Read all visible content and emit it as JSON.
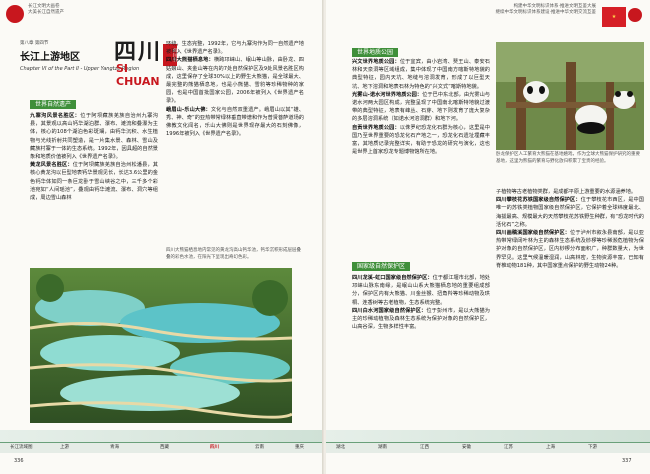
{
  "left_page": {
    "header": {
      "logo_text_1": "长江文明大画卷",
      "logo_text_2": "大美长江自然遗产"
    },
    "chapter": {
      "prefix_cn": "长江上游地区",
      "chapter_no": "第八章 第四节",
      "chapter_en": "Chapter VI of the Part II - Upper Yangtze Region",
      "name_cn": "四川",
      "name_en": "SI CHUAN",
      "code": "四川省"
    },
    "tag_natural_heritage": "世界自然遗产",
    "sections": [
      {
        "title": "九寨沟风景名胜区：",
        "text": "位于阿坝藏族羌族自治州九寨沟县，其景观以高山钙华湖泊群、瀑布、滩流和叠瀑为主体，核心的108个湖泊色彩斑斓，由钙华沉积、水生植物与光线折射共同塑造，是一片集水景、森林、雪山及藏族村寨于一体的生态系统。1992年，因具超的自然景象和地质价值被列入《世界遗产名录》。"
      },
      {
        "title": "黄龙风景名胜区：",
        "text": "位于阿坝藏族羌族自治州松潘县，其核心黄龙沟以巨型地表钙华景观见长，长达3.6公里的金色钙华体如同一条巨龙卧于雪山峡谷之中，三千多个彩池宛如“人间瑶池”，叠观由钙华滩流、瀑布、洞穴等组成，周边雪山森林"
      }
    ],
    "col2_sections": [
      {
        "title": "",
        "text": "环绕，生态完整，1992年，它与九寨沟作为同一自然遗产地被列入《世界遗产名录》。"
      },
      {
        "title": "四川大熊猫栖息地：",
        "text": "横跨邛崃山、岷山等山脉，由卧龙、四姑娘山、夹金山等在内的7处自然保护区及9处风景名胜区构成，这里保存了全球30%以上的野生大熊猫，是全球最大、最完整的熊猫栖息地，也是小熊猫、雪豹等珍稀物种的家园，也是中国首批国家公园，2006年被列入《世界遗产名录》。"
      },
      {
        "title": "峨眉山-乐山大佛：",
        "text": "文化与自然双重遗产。峨眉山以其“雄、秀、神、奇”的亚热带常绿林垂直带谱和作为普贤菩萨道场的佛教文化闻名，乐山大佛则是世界现存最大的石刻佛像，1996年被列入《世界遗产名录》。"
      }
    ],
    "photo_note": "四川大熊猫栖息地内常见的黄龙沟高山钙华池，钙华沉积形成层层叠叠的彩色水池，在阳光下呈现出奇幻色彩。",
    "bottom_nav": {
      "label": "长江流域图",
      "page_number": "336",
      "places": [
        "上游",
        "青海",
        "西藏",
        "四川",
        "云南",
        "重庆"
      ]
    }
  },
  "right_page": {
    "header": {
      "line_1": "构建中华文明标识体系·推进文明互鉴大展",
      "line_2": "继续中华文明标识体系建设·推进中华文明交流互鉴"
    },
    "tag_geopark": "世界地质公园",
    "sections": [
      {
        "title": "兴文世界地质公园：",
        "text": "位于宜宾，由小岩湾、僰王山、泰安石林和天泉洞等区域组成，集中体现了中国南方喀斯特地貌的典型特征，园内天坑、地缝与溶洞发育，形成了以巨型天坑、地下溶洞和地表石林为特色的“兴文式”喀斯特地貌。"
      },
      {
        "title": "光雾山-诺水河世界地质公园：",
        "text": "位于巴中东北部，由光雾山与诺水河两大园区构成，完整呈现了中国南北喀斯特地貌过渡带的典型特征，地表有峰丛、石芽、地下则发育了庞大复杂的多层溶洞系统（如诺水河溶洞群）和地下河。"
      },
      {
        "title": "自贡世界地质公园：",
        "text": "以侏罗纪恐龙化石群为核心，这里是中国乃至世界重要的恐龙化石产地之一，恐龙化石遗址埋藏丰富，其地质记录完整详实，有助于恐龙的研究与演化，这也是世界上首家恐龙专题博物馆所在地。"
      }
    ],
    "photo_caption": "卧龙保护区人工繁育大熊猫在基地嬉戏，作为全球大熊猫保护研究的重要基地，这里为熊猫的繁育与野化放归积累了宝贵的经验。",
    "tag_nature_reserve": "国家级自然保护区",
    "reserves_left": [
      {
        "title": "四川龙溪-虹口国家级自然保护区：",
        "text": "位于都江堰市北部，地处邛崃山脉东南缘，是岷山山系大熊猫栖息地的重要组成部分，保护区内有大熊猫、川金丝猴、扭角羚等珍稀动物及珙桐、连香树等古老植物，生态系统完整。"
      },
      {
        "title": "四川白水河国家级自然保护区：",
        "text": "位于彭州市，是以大熊猫为主的珍稀动植物及森林生态系统为保护对象的自然保护区，山高谷深，生物多样性丰富。"
      }
    ],
    "reserves_right": [
      {
        "title": "",
        "text": "子植物等古老植物类群，是成都平原上游重要的水源涵养地。"
      },
      {
        "title": "四川攀枝花苏铁国家级自然保护区：",
        "text": "位于攀枝花市西区，是中国唯一的苏铁类植物国家级自然保护区，它保护着全球纬度最北、海拔最高、规模最大的天然攀枝花苏铁野生种群，有“恐龙时代的活化石”之称。"
      },
      {
        "title": "四川画稿溪国家级自然保护区：",
        "text": "位于泸州市叙永县南部，是以亚热带常绿阔叶林为主的森林生态系统及桫椤等珍稀濒危植物为保护对象的自然保护区，区内桫椤分布面积广，种群数量大，为世界罕见。这里气候温暖湿润，山高林密，生物资源丰富，已知有脊椎动物181种，其中国家重点保护的野生动物24种。"
      }
    ],
    "bottom_nav": {
      "page_number": "337",
      "places": [
        "湖北",
        "湖南",
        "江西",
        "安徽",
        "江苏",
        "上海",
        "下游"
      ]
    }
  },
  "colors": {
    "accent_green": "#3f8f3a",
    "brand_red": "#c8171e"
  }
}
